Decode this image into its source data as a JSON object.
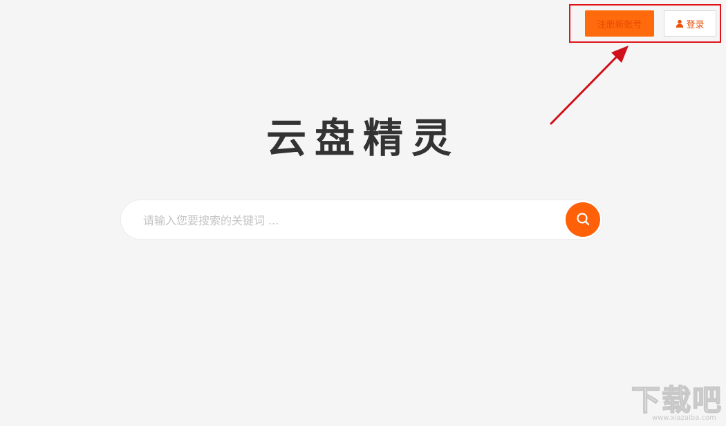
{
  "header": {
    "register_label": "注册新账号",
    "login_label": "登录"
  },
  "logo": {
    "text": "云盘精灵"
  },
  "search": {
    "placeholder": "请输入您要搜索的关键词 ..."
  },
  "watermark": {
    "text": "下载吧",
    "url": "www.xiazaiba.com"
  },
  "colors": {
    "accent": "#ff6008",
    "annotation": "#e0121a",
    "background": "#f5f5f5"
  },
  "icons": {
    "login": "user-icon",
    "search": "search-icon",
    "annotation": "arrow-icon"
  }
}
